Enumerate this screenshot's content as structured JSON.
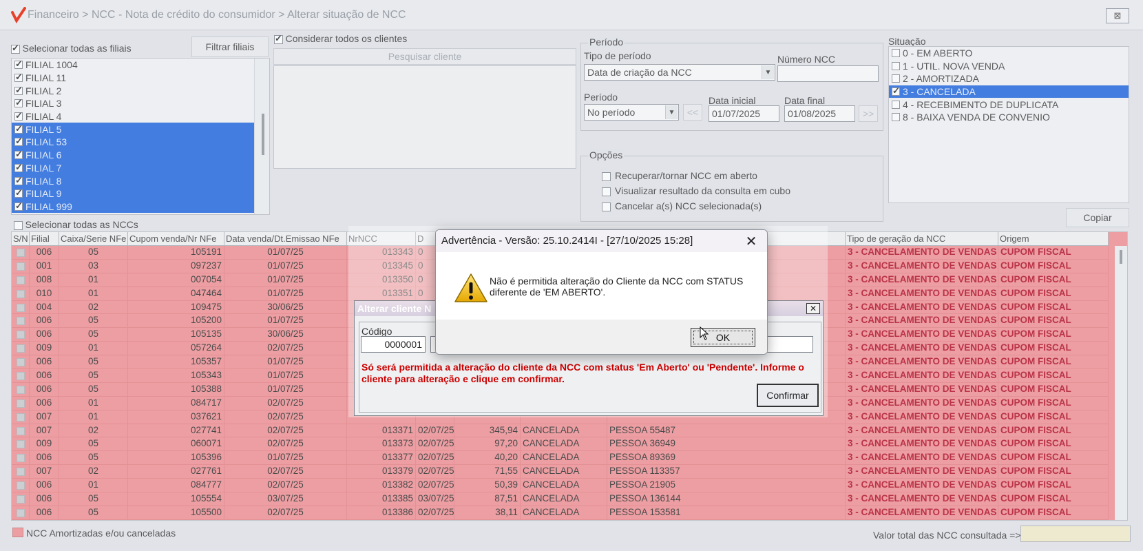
{
  "window": {
    "title": "Financeiro > NCC - Nota de crédito do consumidor > Alterar situação de NCC"
  },
  "filiais": {
    "select_all_label": "Selecionar todas as filiais",
    "filter_button": "Filtrar filiais",
    "items": [
      {
        "label": "FILIAL 1004",
        "checked": true,
        "selected": false
      },
      {
        "label": "FILIAL 11",
        "checked": true,
        "selected": false
      },
      {
        "label": "FILIAL 2",
        "checked": true,
        "selected": false
      },
      {
        "label": "FILIAL 3",
        "checked": true,
        "selected": false
      },
      {
        "label": "FILIAL 4",
        "checked": true,
        "selected": false
      },
      {
        "label": "FILIAL 5",
        "checked": true,
        "selected": true
      },
      {
        "label": "FILIAL 53",
        "checked": true,
        "selected": true
      },
      {
        "label": "FILIAL 6",
        "checked": true,
        "selected": true
      },
      {
        "label": "FILIAL 7",
        "checked": true,
        "selected": true
      },
      {
        "label": "FILIAL 8",
        "checked": true,
        "selected": true
      },
      {
        "label": "FILIAL 9",
        "checked": true,
        "selected": true
      },
      {
        "label": "FILIAL 999",
        "checked": true,
        "selected": true
      }
    ]
  },
  "clientes": {
    "consider_all_label": "Considerar todos os clientes",
    "search_button": "Pesquisar cliente"
  },
  "periodo": {
    "group_title": "Período",
    "tipo_label": "Tipo de período",
    "tipo_value": "Data de criação da NCC",
    "numero_label": "Número NCC",
    "numero_value": "",
    "periodo_label": "Período",
    "periodo_value": "No período",
    "prev_button": "<<",
    "next_button": ">>",
    "data_inicial_label": "Data inicial",
    "data_inicial": "01/07/2025",
    "data_final_label": "Data final",
    "data_final": "01/08/2025"
  },
  "opcoes": {
    "group_title": "Opções",
    "items": [
      "Recuperar/tornar NCC em aberto",
      "Visualizar resultado da consulta em cubo",
      "Cancelar a(s) NCC selecionada(s)"
    ]
  },
  "situacao": {
    "title": "Situação",
    "items": [
      {
        "label": "0 - EM ABERTO",
        "checked": false,
        "selected": false
      },
      {
        "label": "1 - UTIL. NOVA VENDA",
        "checked": false,
        "selected": false
      },
      {
        "label": "2 - AMORTIZADA",
        "checked": false,
        "selected": false
      },
      {
        "label": "3 - CANCELADA",
        "checked": true,
        "selected": true
      },
      {
        "label": "4 - RECEBIMENTO DE DUPLICATA",
        "checked": false,
        "selected": false
      },
      {
        "label": "8 - BAIXA VENDA DE CONVENIO",
        "checked": false,
        "selected": false
      }
    ]
  },
  "copy_button": "Copiar",
  "ncc_select_all_label": "Selecionar todas as NCCs",
  "grid": {
    "columns": [
      "S/N",
      "Filial",
      "Caixa/Serie NFe",
      "Cupom venda/Nr NFe",
      "Data venda/Dt.Emissao NFe",
      "NrNCC",
      "D",
      "",
      "",
      "",
      "Tipo de geração da NCC",
      "Origem"
    ],
    "rows": [
      [
        "006",
        "05",
        "105191",
        "01/07/25",
        "013343",
        "0",
        "",
        "",
        "",
        "3 - CANCELAMENTO DE VENDAS",
        "CUPOM FISCAL"
      ],
      [
        "001",
        "03",
        "097237",
        "01/07/25",
        "013345",
        "0",
        "",
        "",
        "",
        "3 - CANCELAMENTO DE VENDAS",
        "CUPOM FISCAL"
      ],
      [
        "008",
        "01",
        "007054",
        "01/07/25",
        "013350",
        "0",
        "",
        "",
        "",
        "3 - CANCELAMENTO DE VENDAS",
        "CUPOM FISCAL"
      ],
      [
        "010",
        "01",
        "047464",
        "01/07/25",
        "013351",
        "0",
        "",
        "",
        "",
        "3 - CANCELAMENTO DE VENDAS",
        "CUPOM FISCAL"
      ],
      [
        "004",
        "02",
        "109475",
        "30/06/25",
        "",
        "",
        "",
        "",
        "",
        "3 - CANCELAMENTO DE VENDAS",
        "CUPOM FISCAL"
      ],
      [
        "006",
        "05",
        "105200",
        "01/07/25",
        "",
        "",
        "",
        "",
        "",
        "3 - CANCELAMENTO DE VENDAS",
        "CUPOM FISCAL"
      ],
      [
        "006",
        "05",
        "105135",
        "30/06/25",
        "",
        "",
        "",
        "",
        "",
        "3 - CANCELAMENTO DE VENDAS",
        "CUPOM FISCAL"
      ],
      [
        "009",
        "01",
        "057264",
        "02/07/25",
        "",
        "",
        "",
        "",
        "",
        "3 - CANCELAMENTO DE VENDAS",
        "CUPOM FISCAL"
      ],
      [
        "006",
        "05",
        "105357",
        "01/07/25",
        "",
        "",
        "",
        "",
        "",
        "3 - CANCELAMENTO DE VENDAS",
        "CUPOM FISCAL"
      ],
      [
        "006",
        "05",
        "105343",
        "01/07/25",
        "",
        "",
        "",
        "",
        "",
        "3 - CANCELAMENTO DE VENDAS",
        "CUPOM FISCAL"
      ],
      [
        "006",
        "05",
        "105388",
        "01/07/25",
        "",
        "",
        "",
        "",
        "",
        "3 - CANCELAMENTO DE VENDAS",
        "CUPOM FISCAL"
      ],
      [
        "006",
        "01",
        "084717",
        "02/07/25",
        "",
        "",
        "",
        "",
        "",
        "3 - CANCELAMENTO DE VENDAS",
        "CUPOM FISCAL"
      ],
      [
        "007",
        "01",
        "037621",
        "02/07/25",
        "",
        "",
        "",
        "",
        "",
        "3 - CANCELAMENTO DE VENDAS",
        "CUPOM FISCAL"
      ],
      [
        "007",
        "02",
        "027741",
        "02/07/25",
        "013371",
        "02/07/25",
        "345,94",
        "CANCELADA",
        "PESSOA 55487",
        "3 - CANCELAMENTO DE VENDAS",
        "CUPOM FISCAL"
      ],
      [
        "009",
        "05",
        "060071",
        "02/07/25",
        "013373",
        "02/07/25",
        "97,20",
        "CANCELADA",
        "PESSOA 36949",
        "3 - CANCELAMENTO DE VENDAS",
        "CUPOM FISCAL"
      ],
      [
        "006",
        "05",
        "105396",
        "01/07/25",
        "013377",
        "02/07/25",
        "40,20",
        "CANCELADA",
        "PESSOA 89369",
        "3 - CANCELAMENTO DE VENDAS",
        "CUPOM FISCAL"
      ],
      [
        "007",
        "02",
        "027761",
        "02/07/25",
        "013379",
        "02/07/25",
        "71,55",
        "CANCELADA",
        "PESSOA 113357",
        "3 - CANCELAMENTO DE VENDAS",
        "CUPOM FISCAL"
      ],
      [
        "006",
        "01",
        "084777",
        "02/07/25",
        "013382",
        "02/07/25",
        "50,39",
        "CANCELADA",
        "PESSOA 21905",
        "3 - CANCELAMENTO DE VENDAS",
        "CUPOM FISCAL"
      ],
      [
        "006",
        "05",
        "105554",
        "03/07/25",
        "013385",
        "03/07/25",
        "87,51",
        "CANCELADA",
        "PESSOA 136144",
        "3 - CANCELAMENTO DE VENDAS",
        "CUPOM FISCAL"
      ],
      [
        "006",
        "05",
        "105500",
        "02/07/25",
        "013386",
        "02/07/25",
        "38,11",
        "CANCELADA",
        "PESSOA 153581",
        "3 - CANCELAMENTO DE VENDAS",
        "CUPOM FISCAL"
      ]
    ]
  },
  "legend_text": "NCC Amortizadas e/ou canceladas",
  "total_label": "Valor total das NCC consultada =>",
  "total_value": "",
  "alterar_dialog": {
    "title": "Alterar cliente N",
    "codigo_label": "Código",
    "codigo_value": "0000001",
    "message": "Só será permitida a alteração do cliente da NCC com status 'Em Aberto' ou 'Pendente'. Informe o cliente para alteração e clique em confirmar.",
    "confirm_button": "Confirmar"
  },
  "warning_dialog": {
    "title": "Advertência - Versão: 25.10.2414I - [27/10/2025 15:28]",
    "message": "Não é permitida alteração do Cliente da NCC com STATUS diferente de 'EM ABERTO'.",
    "ok_button": "OK"
  },
  "colors": {
    "row_red": "#f08a8e",
    "select_blue": "#1560dc",
    "warn_red": "#cc0000"
  }
}
